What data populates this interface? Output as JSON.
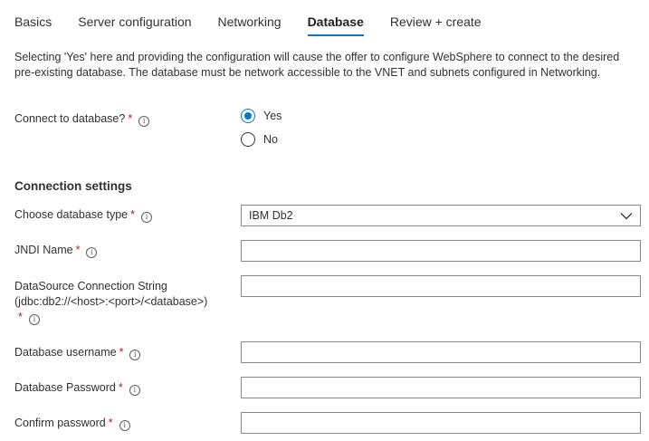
{
  "tabs": [
    {
      "label": "Basics",
      "active": false
    },
    {
      "label": "Server configuration",
      "active": false
    },
    {
      "label": "Networking",
      "active": false
    },
    {
      "label": "Database",
      "active": true
    },
    {
      "label": "Review + create",
      "active": false
    }
  ],
  "description": "Selecting 'Yes' here and providing the configuration will cause the offer to configure WebSphere to connect to the desired pre-existing database. The database must be network accessible to the VNET and subnets configured in Networking.",
  "connect": {
    "label": "Connect to database?",
    "required_mark": "*",
    "options": [
      {
        "label": "Yes",
        "selected": true
      },
      {
        "label": "No",
        "selected": false
      }
    ]
  },
  "connection_settings": {
    "heading": "Connection settings",
    "db_type": {
      "label": "Choose database type",
      "required_mark": "*",
      "value": "IBM Db2"
    },
    "jndi": {
      "label": "JNDI Name",
      "required_mark": "*",
      "value": ""
    },
    "datasource": {
      "label_line1": "DataSource Connection String",
      "label_line2": "(jdbc:db2://<host>:<port>/<database>)",
      "required_mark": "*",
      "value": ""
    },
    "username": {
      "label": "Database username",
      "required_mark": "*",
      "value": ""
    },
    "password": {
      "label": "Database Password",
      "required_mark": "*",
      "value": ""
    },
    "confirm": {
      "label": "Confirm password",
      "required_mark": "*",
      "value": ""
    }
  },
  "colors": {
    "accent": "#0078d4",
    "required": "#a4262c",
    "border": "#8a8886"
  }
}
